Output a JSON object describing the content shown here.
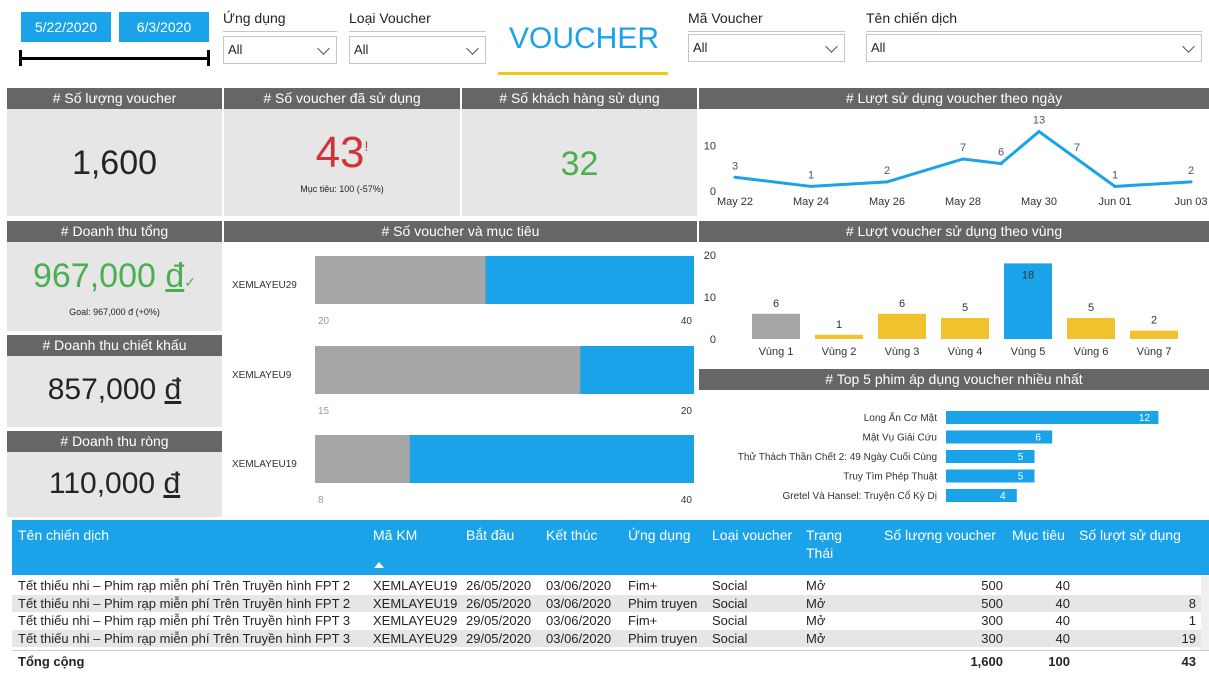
{
  "filters": {
    "date_start": "5/22/2020",
    "date_end": "6/3/2020",
    "ung_dung_label": "Ứng dụng",
    "ung_dung_value": "All",
    "loai_voucher_label": "Loại Voucher",
    "loai_voucher_value": "All",
    "ma_voucher_label": "Mã Voucher",
    "ma_voucher_value": "All",
    "ten_chien_dich_label": "Tên chiến dịch",
    "ten_chien_dich_value": "All"
  },
  "page_title": "VOUCHER",
  "kpis": {
    "so_luong_voucher": {
      "title": "# Số lượng voucher",
      "value": "1,600"
    },
    "so_voucher_da_su_dung": {
      "title": "# Số voucher đã sử dụng",
      "value": "43",
      "flag": "!",
      "goal_text": "Mục tiêu: 100 (-57%)"
    },
    "so_khach_hang": {
      "title": "# Số khách hàng sử dụng",
      "value": "32"
    },
    "doanh_thu_tong": {
      "title": "# Doanh thu tổng",
      "value": "967,000",
      "currency": "đ",
      "check": "✓",
      "goal_text": "Goal: 967,000 đ (+0%)"
    },
    "doanh_thu_chiet_khau": {
      "title": "# Doanh thu chiết khấu",
      "value": "857,000",
      "currency": "đ"
    },
    "doanh_thu_rong": {
      "title": "# Doanh thu ròng",
      "value": "110,000",
      "currency": "đ"
    }
  },
  "colors": {
    "accent": "#1aa3e8",
    "gray_bar": "#a6a6a6",
    "yellow": "#f2c12e",
    "header": "#666666",
    "card_bg": "#e6e6e6",
    "red": "#d13438",
    "green": "#4caf50"
  },
  "chart_data": [
    {
      "type": "line",
      "title": "# Lượt sử dụng voucher theo ngày",
      "x": [
        "May 22",
        "May 23",
        "May 24",
        "May 25",
        "May 26",
        "May 27",
        "May 28",
        "May 29",
        "May 30",
        "May 31",
        "Jun 01",
        "Jun 02",
        "Jun 03"
      ],
      "x_tick_labels": [
        "May 22",
        "May 24",
        "May 26",
        "May 28",
        "May 30",
        "Jun 01",
        "Jun 03"
      ],
      "values": [
        3,
        null,
        1,
        null,
        2,
        null,
        7,
        6,
        13,
        7,
        1,
        null,
        2
      ],
      "yticks": [
        0,
        10
      ],
      "ylim": [
        0,
        14
      ]
    },
    {
      "type": "bar",
      "title": "# Số voucher và mục tiêu",
      "orientation": "horizontal",
      "groups": [
        {
          "label": "XEMLAYEU29",
          "axis_min": 20,
          "axis_max": 40,
          "gray_value": 29,
          "blue_value": 40,
          "min_label": "20",
          "max_label": "40"
        },
        {
          "label": "XEMLAYEU9",
          "axis_min": 15,
          "axis_max": 20,
          "gray_value": 18.5,
          "blue_value": 20,
          "min_label": "15",
          "max_label": "20"
        },
        {
          "label": "XEMLAYEU19",
          "axis_min": 8,
          "axis_max": 40,
          "gray_value": 16,
          "blue_value": 40,
          "min_label": "8",
          "max_label": "40"
        }
      ]
    },
    {
      "type": "bar",
      "title": "# Lượt voucher sử dụng theo vùng",
      "categories": [
        "Vùng 1",
        "Vùng 2",
        "Vùng 3",
        "Vùng 4",
        "Vùng 5",
        "Vùng 6",
        "Vùng 7"
      ],
      "values": [
        6,
        1,
        6,
        5,
        18,
        5,
        2
      ],
      "bar_colors": [
        "gray",
        "yellow",
        "yellow",
        "yellow",
        "blue",
        "yellow",
        "yellow"
      ],
      "yticks": [
        0,
        10,
        20
      ],
      "ylim": [
        0,
        20
      ]
    },
    {
      "type": "bar",
      "title": "# Top 5 phim áp dụng voucher nhiều nhất",
      "orientation": "horizontal",
      "categories": [
        "Long Ẩn Cơ Mật",
        "Mật Vụ Giải Cứu",
        "Thử Thách Thần Chết 2: 49 Ngày Cuối Cùng",
        "Truy Tìm Phép Thuật",
        "Gretel Và Hansel: Truyện Cổ Kỳ Dị"
      ],
      "values": [
        12,
        6,
        5,
        5,
        4
      ]
    }
  ],
  "table": {
    "headers": [
      "Tên chiến dịch",
      "Mã KM",
      "Bắt đầu",
      "Kết thúc",
      "Ứng dụng",
      "Loại voucher",
      "Trạng Thái",
      "Số lượng voucher",
      "Mục tiêu",
      "Số lượt sử dụng"
    ],
    "rows": [
      [
        "Tết thiếu nhi – Phim rạp miễn phí Trên Truyền hình FPT 2",
        "XEMLAYEU19",
        "26/05/2020",
        "03/06/2020",
        "Fim+",
        "Social",
        "Mở",
        "500",
        "40",
        ""
      ],
      [
        "Tết thiếu nhi – Phim rạp miễn phí Trên Truyền hình FPT 2",
        "XEMLAYEU19",
        "26/05/2020",
        "03/06/2020",
        "Phim truyen",
        "Social",
        "Mở",
        "500",
        "40",
        "8"
      ],
      [
        "Tết thiếu nhi – Phim rạp miễn phí Trên Truyền hình FPT 3",
        "XEMLAYEU29",
        "29/05/2020",
        "03/06/2020",
        "Fim+",
        "Social",
        "Mở",
        "300",
        "40",
        "1"
      ],
      [
        "Tết thiếu nhi – Phim rạp miễn phí Trên Truyền hình FPT 3",
        "XEMLAYEU29",
        "29/05/2020",
        "03/06/2020",
        "Phim truyen",
        "Social",
        "Mở",
        "300",
        "40",
        "19"
      ]
    ],
    "total": {
      "label": "Tổng cộng",
      "so_luong": "1,600",
      "muc_tieu": "100",
      "so_luot": "43"
    }
  }
}
